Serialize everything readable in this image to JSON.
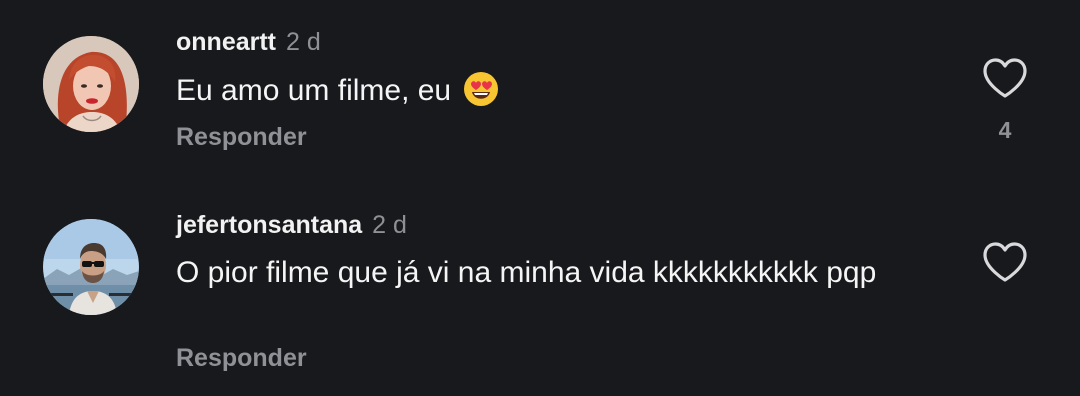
{
  "comments": [
    {
      "username": "onneartt",
      "time": "2 d",
      "text": "Eu amo um filme, eu",
      "emoji": "heart-eyes-emoji",
      "reply_label": "Responder",
      "likes": "4",
      "avatar": "avatar-red-hair"
    },
    {
      "username": "jefertonsantana",
      "time": "2 d",
      "text": "O pior filme que já vi na minha vida kkkkkkkkkkk pqp",
      "reply_label": "Responder",
      "avatar": "avatar-sunglasses"
    }
  ],
  "icons": {
    "like": "heart-outline-icon"
  },
  "colors": {
    "background": "#17191c",
    "text": "#f2f2f2",
    "muted": "#8f9196"
  }
}
